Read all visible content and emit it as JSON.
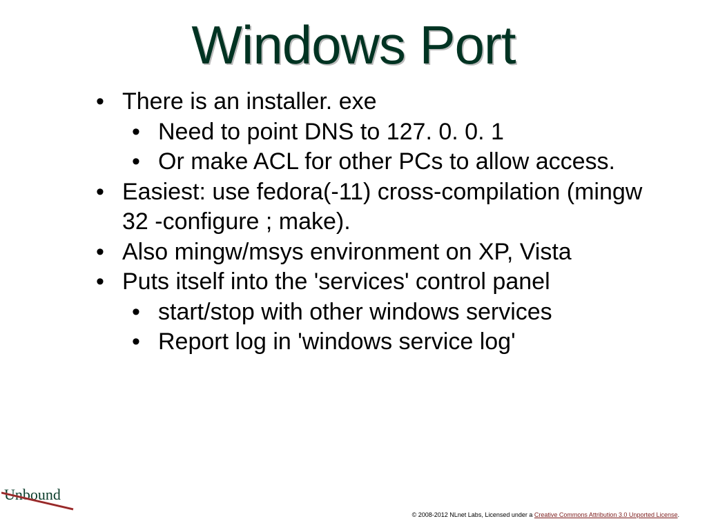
{
  "title": "Windows Port",
  "bullets": {
    "b1": "There is an installer. exe",
    "b1a": "Need to point DNS to 127. 0. 0. 1",
    "b1b": "Or make ACL for other PCs to allow access.",
    "b2": "Easiest: use fedora(-11) cross-compilation (mingw 32 -configure ; make).",
    "b3": "Also mingw/msys environment on XP, Vista",
    "b4": "Puts itself into the 'services' control panel",
    "b4a": "start/stop with other windows services",
    "b4b": "Report log in 'windows service log'"
  },
  "logo": "Unbound",
  "footer": {
    "prefix": "© 2008-2012 NLnet Labs, Licensed under a ",
    "link": "Creative Commons Attribution 3.0 Unported License",
    "suffix": "."
  }
}
